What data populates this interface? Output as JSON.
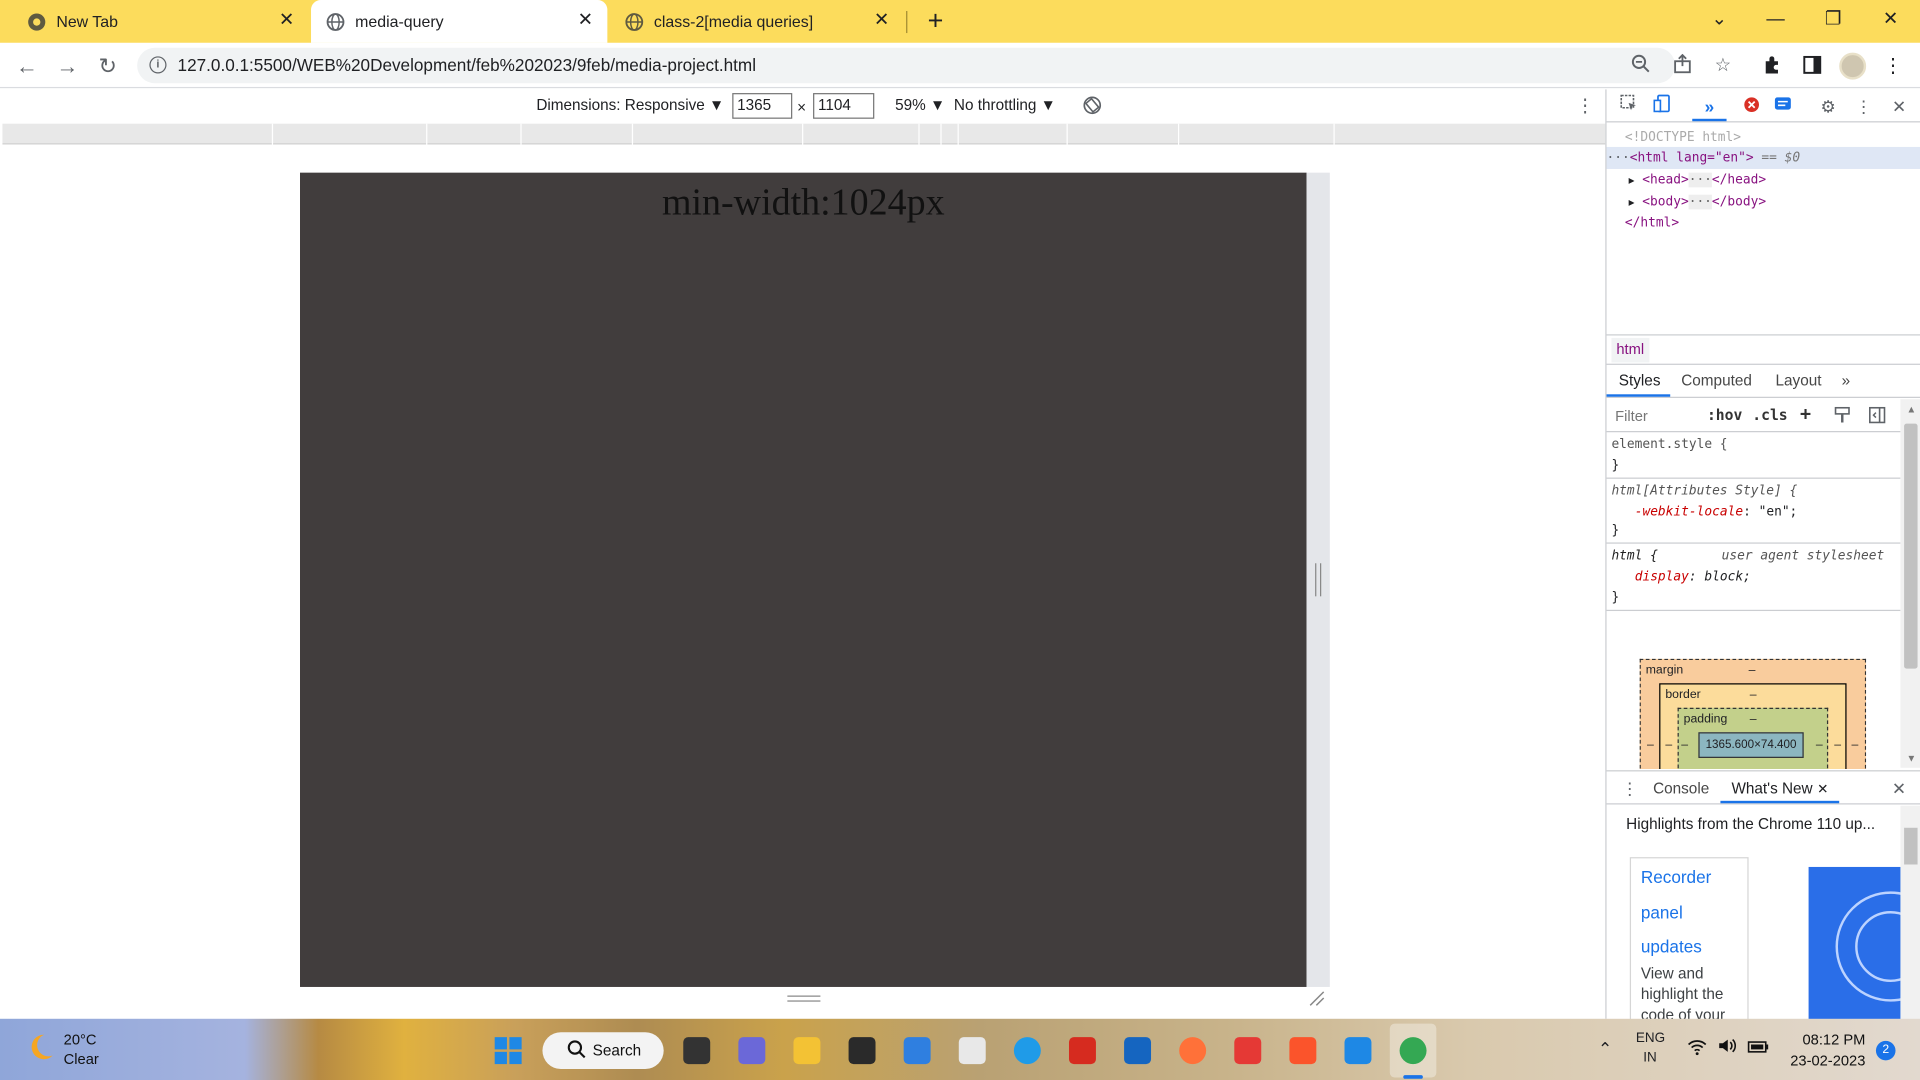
{
  "tabs": [
    {
      "title": "New Tab",
      "close": "✕"
    },
    {
      "title": "media-query",
      "close": "✕"
    },
    {
      "title": "class-2[media queries]",
      "close": "✕"
    }
  ],
  "new_tab_label": "+",
  "window_controls": {
    "minimize": "—",
    "restore": "❐",
    "close": "✕",
    "tab_search": "⌄"
  },
  "address": {
    "url": "127.0.0.1:5500/WEB%20Development/feb%202023/9feb/media-project.html"
  },
  "device_toolbar": {
    "dimensions_label": "Dimensions: Responsive ▼",
    "width": "1365",
    "height": "1104",
    "times": "×",
    "zoom": "59% ▼",
    "throttling": "No throttling ▼"
  },
  "page": {
    "heading": "min-width:1024px",
    "background": "#413d3d"
  },
  "devtools": {
    "dom": {
      "doctype": "<!DOCTYPE html>",
      "html_open": "<html lang=\"en\">",
      "eq": "== $0",
      "head": "<head>",
      "head_close": "</head>",
      "body": "<body>",
      "body_close": "</body>",
      "html_close": "</html>",
      "ellipsis": "···"
    },
    "breadcrumb": "html",
    "styles_tabs": [
      "Styles",
      "Computed",
      "Layout"
    ],
    "more": "»",
    "filter_placeholder": "Filter",
    "filter_tools": {
      "hov": ":hov",
      "cls": ".cls",
      "plus": "+"
    },
    "rules": {
      "element_style": "element.style {",
      "close": "}",
      "attr_sel": "html[Attributes Style] {",
      "attr_prop": "-webkit-locale",
      "attr_val": "\"en\";",
      "ua_sel": "html {",
      "ua_src": "user agent stylesheet",
      "ua_prop": "display",
      "ua_val": "block;"
    },
    "box_model": {
      "margin": "margin",
      "border": "border",
      "padding": "padding",
      "dash": "–",
      "content": "1365.600×74.400"
    },
    "drawer": {
      "tabs": [
        "Console",
        "What's New"
      ],
      "tab_close": "✕",
      "headline": "Highlights from the Chrome 110 up...",
      "card_title": [
        "Recorder",
        "panel",
        "updates"
      ],
      "card_body": [
        "View and",
        "highlight the",
        "code of your"
      ]
    }
  },
  "taskbar": {
    "temp": "20°C",
    "condition": "Clear",
    "search": "Search",
    "lang1": "ENG",
    "lang2": "IN",
    "time": "08:12 PM",
    "date": "23-02-2023",
    "badge": "2"
  }
}
